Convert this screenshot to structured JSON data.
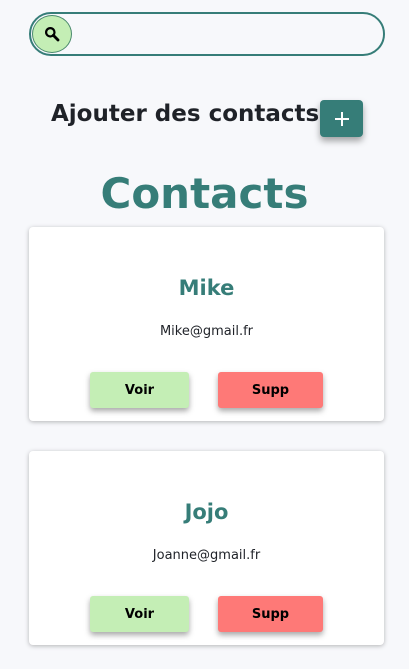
{
  "search": {
    "value": "",
    "placeholder": "",
    "icon": "search-icon"
  },
  "add_contact": {
    "label": "Ajouter des contacts",
    "button_icon": "plus-icon"
  },
  "page_title": "Contacts",
  "contacts": [
    {
      "name": "Mike",
      "email": "Mike@gmail.fr",
      "view_label": "Voir",
      "delete_label": "Supp"
    },
    {
      "name": "Jojo",
      "email": "Joanne@gmail.fr",
      "view_label": "Voir",
      "delete_label": "Supp"
    }
  ],
  "colors": {
    "accent": "#367d78",
    "view_button": "#c4eeb5",
    "delete_button": "#fe7977",
    "background": "#f7f8fb"
  }
}
